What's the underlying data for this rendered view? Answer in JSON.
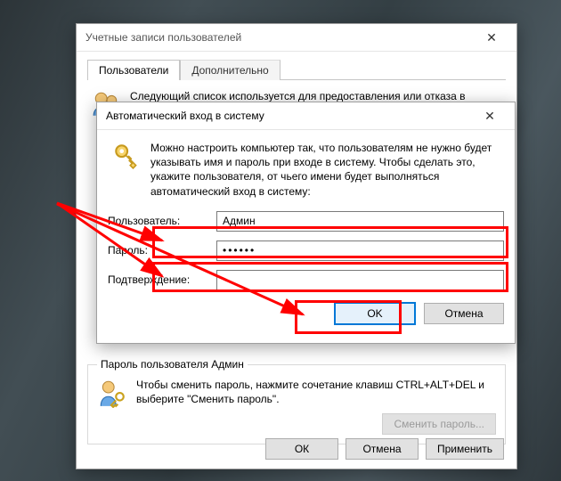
{
  "parent": {
    "title": "Учетные записи пользователей",
    "tabs": [
      "Пользователи",
      "Дополнительно"
    ],
    "intro": "Следующий список используется для предоставления или отказа в доступе к вашему компьютеру, а также для смены паролей и",
    "group_title": "Пароль пользователя Админ",
    "group_text": "Чтобы сменить пароль, нажмите сочетание клавиш CTRL+ALT+DEL и выберите \"Сменить пароль\".",
    "change_pwd_btn": "Сменить пароль...",
    "ok": "ОК",
    "cancel": "Отмена",
    "apply": "Применить"
  },
  "dialog": {
    "title": "Автоматический вход в систему",
    "desc": "Можно настроить компьютер так, что пользователям не нужно будет указывать имя и пароль при входе в систему. Чтобы сделать это, укажите пользователя, от чьего имени будет выполняться автоматический вход в систему:",
    "user_label": "Пользователь:",
    "user_value": "Админ",
    "pwd_label": "Пароль:",
    "pwd_value": "••••••",
    "confirm_label": "Подтверждение:",
    "confirm_value": "",
    "ok": "OK",
    "cancel": "Отмена"
  }
}
